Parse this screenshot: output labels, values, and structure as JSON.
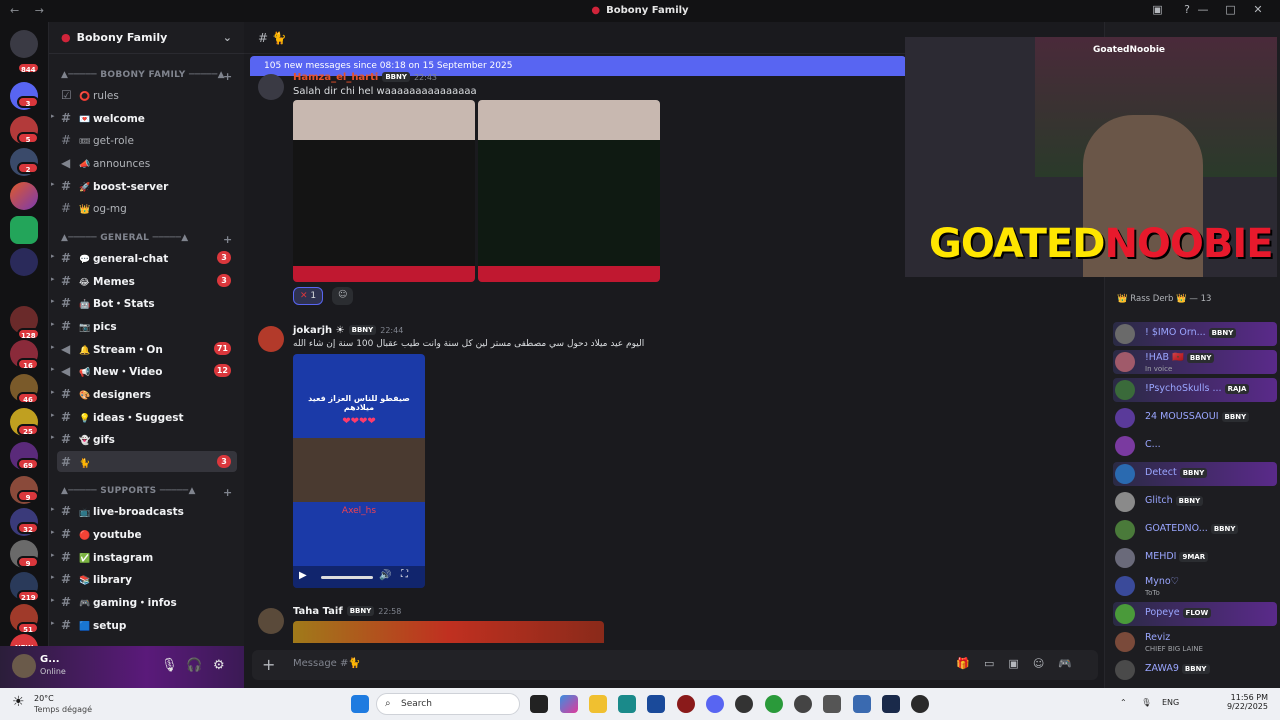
{
  "titlebar": {
    "title": "Bobony Family"
  },
  "server": {
    "name": "Bobony Family"
  },
  "guild_badges": [
    "844",
    "3",
    "5",
    "2",
    "128",
    "16",
    "46",
    "25",
    "69",
    "9",
    "32",
    "9",
    "219",
    "51",
    "9"
  ],
  "categories": [
    {
      "label": "▲───── BOBONY FAMILY ─────▲"
    },
    {
      "label": "▲───── GENERAL ─────▲"
    },
    {
      "label": "▲───── SUPPORTS ─────▲"
    }
  ],
  "channels": [
    {
      "name": "rules",
      "emoji": "⭕",
      "badge": ""
    },
    {
      "name": "welcome",
      "emoji": "💌",
      "badge": ""
    },
    {
      "name": "get-role",
      "emoji": "🎟",
      "badge": ""
    },
    {
      "name": "announces",
      "emoji": "📣",
      "badge": ""
    },
    {
      "name": "boost-server",
      "emoji": "🚀",
      "badge": ""
    },
    {
      "name": "og-mg",
      "emoji": "👑",
      "badge": ""
    },
    {
      "name": "general-chat",
      "emoji": "💬",
      "badge": "3"
    },
    {
      "name": "Memes",
      "emoji": "😂",
      "badge": "3"
    },
    {
      "name": "Bot・Stats",
      "emoji": "🤖",
      "badge": ""
    },
    {
      "name": "pics",
      "emoji": "📷",
      "badge": ""
    },
    {
      "name": "Stream・On",
      "emoji": "🔔",
      "badge": "71"
    },
    {
      "name": "New・Video",
      "emoji": "📢",
      "badge": "12"
    },
    {
      "name": "designers",
      "emoji": "🎨",
      "badge": ""
    },
    {
      "name": "ideas・Suggest",
      "emoji": "💡",
      "badge": ""
    },
    {
      "name": "gifs",
      "emoji": "👻",
      "badge": ""
    },
    {
      "name": "",
      "emoji": "🐈",
      "badge": "3"
    },
    {
      "name": "live-broadcasts",
      "emoji": "📺",
      "badge": ""
    },
    {
      "name": "youtube",
      "emoji": "🔴",
      "badge": ""
    },
    {
      "name": "instagram",
      "emoji": "✅",
      "badge": ""
    },
    {
      "name": "library",
      "emoji": "📚",
      "badge": ""
    },
    {
      "name": "gaming・infos",
      "emoji": "🎮",
      "badge": ""
    },
    {
      "name": "setup",
      "emoji": "🟦",
      "badge": ""
    }
  ],
  "user": {
    "name": "G...",
    "status": "Online"
  },
  "chat": {
    "channel": "🐈",
    "new_banner": "105 new messages since 08:18 on 15 September 2025",
    "messages": [
      {
        "author": "Hamza_el_harti",
        "tag": "BBNY",
        "time": "22:43",
        "text": "Salah dir chi hel waaaaaaaaaaaaaaa",
        "reaction_count": "1"
      },
      {
        "author": "jokarjh ☀",
        "tag": "BBNY",
        "time": "22:44",
        "text": "اليوم عيد ميلاد دحول سي مصطفى مستر لين كل سنة وانت طيب عقبال 100 سنة إن شاء الله",
        "video_caption": "صيفطو للناس العزاز فعيد ميلادهم",
        "video_hearts": "❤❤❤❤",
        "watermark": "Axel_hs"
      },
      {
        "author": "Taha Taif",
        "tag": "BBNY",
        "time": "22:58",
        "text": ""
      }
    ],
    "composer_placeholder": "Message #🐈"
  },
  "stream": {
    "logo_a": "GOATED",
    "logo_b": "NOOBIE",
    "handle": "GoatedNoobie"
  },
  "members": {
    "group": "👑 Rass Derb 👑 — 13",
    "list": [
      {
        "name": "! $IMO Orn...",
        "tag": "BBNY",
        "sub": ""
      },
      {
        "name": "!HAB 🇲🇦",
        "tag": "BBNY",
        "sub": "In voice"
      },
      {
        "name": "!PsychoSkulls ...",
        "tag": "RAJA",
        "sub": ""
      },
      {
        "name": "24 MOUSSAOUI",
        "tag": "BBNY",
        "sub": ""
      },
      {
        "name": "C...",
        "tag": "",
        "sub": ""
      },
      {
        "name": "Detect",
        "tag": "BBNY",
        "sub": ""
      },
      {
        "name": "Glitch",
        "tag": "BBNY",
        "sub": ""
      },
      {
        "name": "GOATEDNO...",
        "tag": "BBNY",
        "sub": ""
      },
      {
        "name": "MEHDI",
        "tag": "9MAR",
        "sub": ""
      },
      {
        "name": "Myno♡",
        "tag": "",
        "sub": "ToTo"
      },
      {
        "name": "Popeye",
        "tag": "FLOW",
        "sub": ""
      },
      {
        "name": "Reviz",
        "tag": "",
        "sub": "CHIEF BIG LAINE"
      },
      {
        "name": "ZAWA9",
        "tag": "BBNY",
        "sub": ""
      }
    ]
  },
  "taskbar": {
    "weather_temp": "20°C",
    "weather_desc": "Temps dégagé",
    "search": "Search",
    "lang": "ENG",
    "time": "11:56 PM",
    "date": "9/22/2025"
  }
}
